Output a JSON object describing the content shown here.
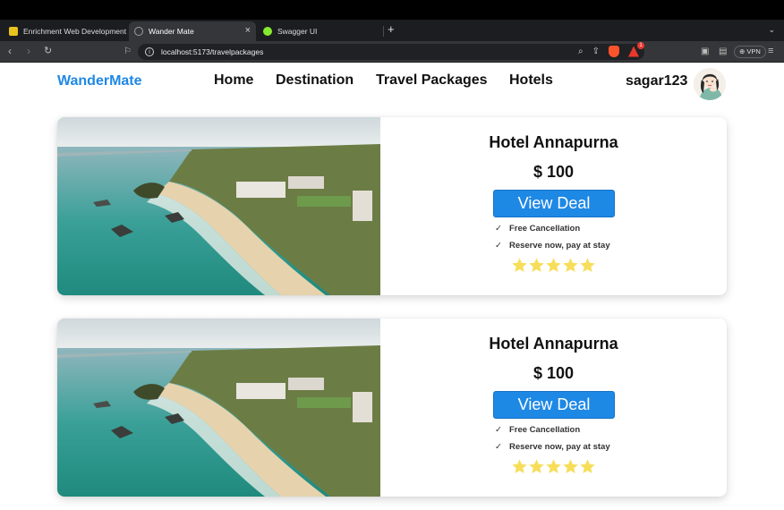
{
  "browser": {
    "tabs": [
      {
        "title": "Enrichment Web Development",
        "favicon": "folder-icon",
        "active": false
      },
      {
        "title": "Wander Mate",
        "favicon": "globe-icon",
        "active": true
      },
      {
        "title": "Swagger UI",
        "favicon": "swagger-icon",
        "active": false
      }
    ],
    "url": "localhost:5173/travelpackages",
    "vpn_label": "VPN",
    "badge_count": "1"
  },
  "site": {
    "logo": "WanderMate",
    "nav": [
      "Home",
      "Destination",
      "Travel Packages",
      "Hotels"
    ],
    "username": "sagar123"
  },
  "cards": [
    {
      "name": "Hotel Annapurna",
      "price": "$ 100",
      "button": "View Deal",
      "features": [
        "Free Cancellation",
        "Reserve now, pay at stay"
      ],
      "rating": 5
    },
    {
      "name": "Hotel Annapurna",
      "price": "$ 100",
      "button": "View Deal",
      "features": [
        "Free Cancellation",
        "Reserve now, pay at stay"
      ],
      "rating": 5
    }
  ],
  "colors": {
    "accent": "#1e88e5",
    "star": "#f7de5a",
    "chrome_dark": "#35363a"
  }
}
